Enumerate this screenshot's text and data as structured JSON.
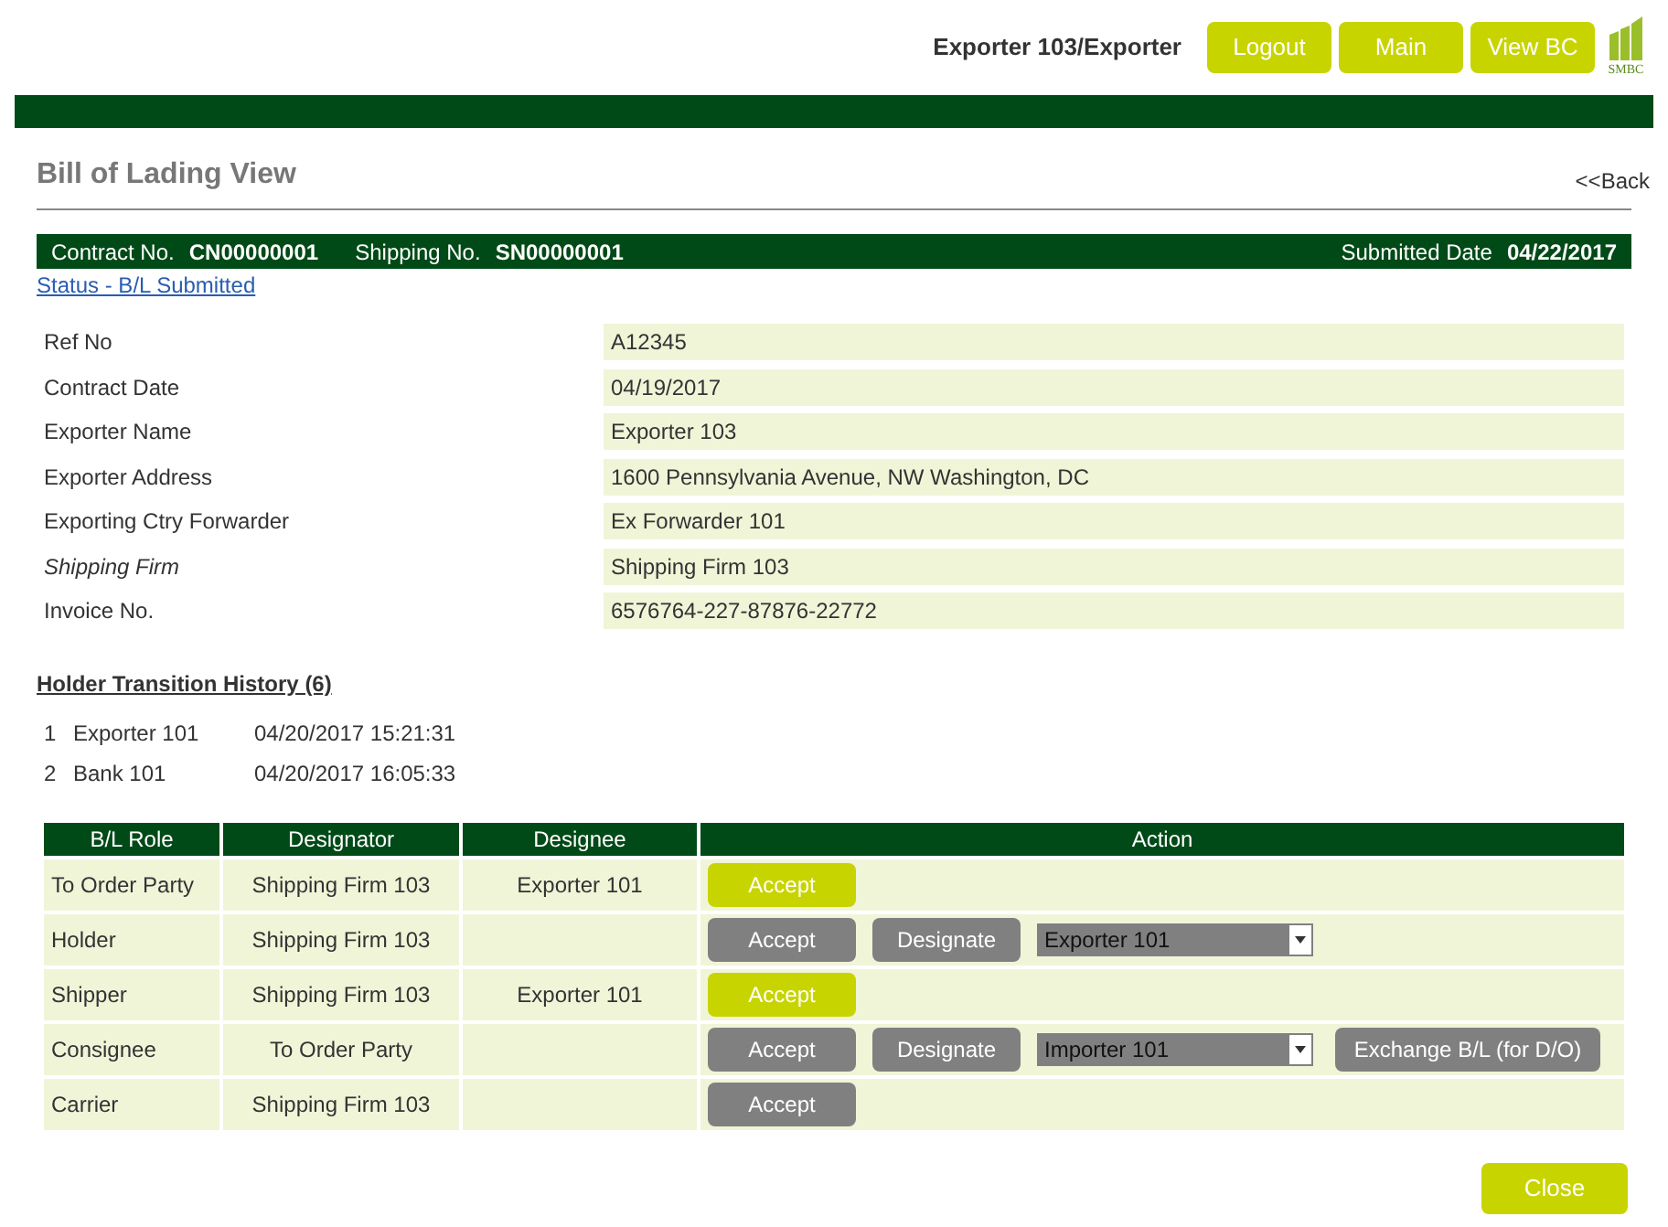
{
  "header": {
    "user": "Exporter 103/Exporter",
    "buttons": [
      "Logout",
      "Main",
      "View BC"
    ],
    "logo": "SMBC"
  },
  "page": {
    "title": "Bill of Lading View",
    "back": "<<Back"
  },
  "info_bar": {
    "contract_label": "Contract No.",
    "contract_no": "CN00000001",
    "shipping_label": "Shipping No.",
    "shipping_no": "SN00000001",
    "submitted_label": "Submitted Date",
    "submitted_date": "04/22/2017"
  },
  "status_link": "Status - B/L Submitted",
  "fields": [
    {
      "label": "Ref No",
      "value": "A12345",
      "italic": false
    },
    {
      "label": "Contract Date",
      "value": "04/19/2017",
      "italic": false
    },
    {
      "label": "Exporter Name",
      "value": "Exporter 103",
      "italic": false
    },
    {
      "label": "Exporter Address",
      "value": "1600 Pennsylvania Avenue, NW Washington, DC",
      "italic": false
    },
    {
      "label": "Exporting Ctry Forwarder",
      "value": "Ex Forwarder 101",
      "italic": false
    },
    {
      "label": "Shipping Firm",
      "value": "Shipping Firm 103",
      "italic": true
    },
    {
      "label": "Invoice No.",
      "value": "6576764-227-87876-22772",
      "italic": false
    }
  ],
  "history": {
    "title": "Holder Transition History (6)",
    "rows": [
      {
        "index": "1",
        "holder": "Exporter 101",
        "time": "04/20/2017 15:21:31"
      },
      {
        "index": "2",
        "holder": "Bank 101",
        "time": "04/20/2017 16:05:33"
      }
    ]
  },
  "table": {
    "columns": [
      "B/L Role",
      "Designator",
      "Designee",
      "Action"
    ],
    "rows": [
      {
        "role": "To Order Party",
        "designator": "Shipping Firm 103",
        "designee": "Exporter 101",
        "accept": {
          "label": "Accept",
          "disabled": false
        }
      },
      {
        "role": "Holder",
        "designator": "Shipping Firm 103",
        "accept": {
          "label": "Accept",
          "disabled": true
        },
        "designate": {
          "label": "Designate",
          "disabled": true
        },
        "select": {
          "value": "Exporter 101",
          "disabled": true
        }
      },
      {
        "role": "Shipper",
        "designator": "Shipping Firm 103",
        "designee": "Exporter 101",
        "accept": {
          "label": "Accept",
          "disabled": false
        }
      },
      {
        "role": "Consignee",
        "designator": "To Order Party",
        "accept": {
          "label": "Accept",
          "disabled": true
        },
        "designate": {
          "label": "Designate",
          "disabled": true
        },
        "select": {
          "value": "Importer 101",
          "disabled": true
        },
        "exchange": {
          "label": "Exchange B/L (for D/O)",
          "disabled": true
        }
      },
      {
        "role": "Carrier",
        "designator": "Shipping Firm 103",
        "accept": {
          "label": "Accept",
          "disabled": true
        }
      }
    ]
  },
  "close_button": "Close"
}
